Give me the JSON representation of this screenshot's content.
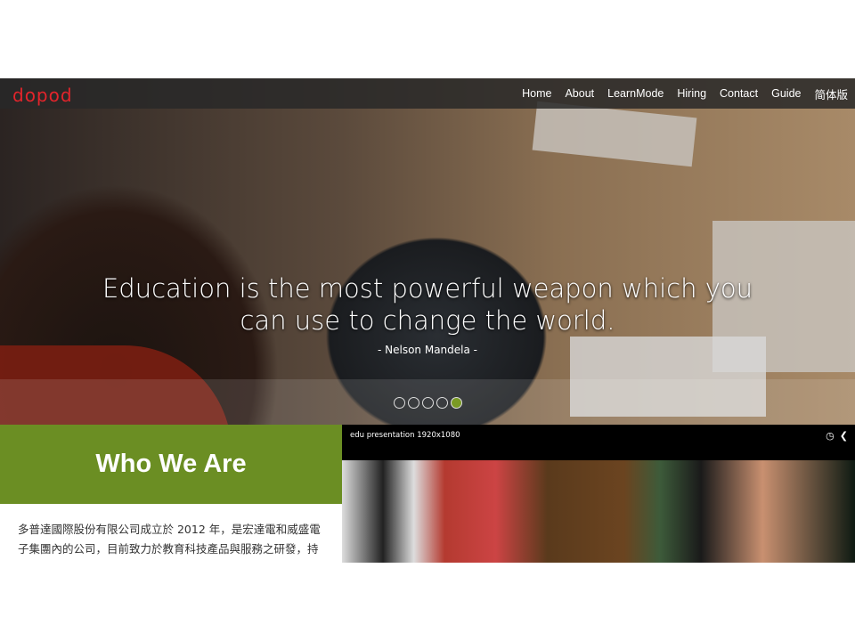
{
  "nav": {
    "logo": "dopod",
    "items": [
      "Home",
      "About",
      "LearnMode",
      "Hiring",
      "Contact",
      "Guide",
      "简体版"
    ]
  },
  "hero": {
    "quote": "Education is the most powerful weapon which you can use to change the world.",
    "author": "- Nelson Mandela -",
    "slides": 5,
    "active_slide": 5
  },
  "who": {
    "title": "Who We Are",
    "text": "多普達國際股份有限公司成立於 2012 年，是宏達電和威盛電子集團內的公司，目前致力於教育科技產品與服務之研發，持續整合雲端科技、軟硬體與數位內容，發展學習平台之多元服務模"
  },
  "video": {
    "title": "edu presentation 1920x1080",
    "icons": [
      "clock-icon",
      "share-icon"
    ]
  },
  "colors": {
    "accent": "#6b8e23",
    "logo": "#e3242b"
  }
}
